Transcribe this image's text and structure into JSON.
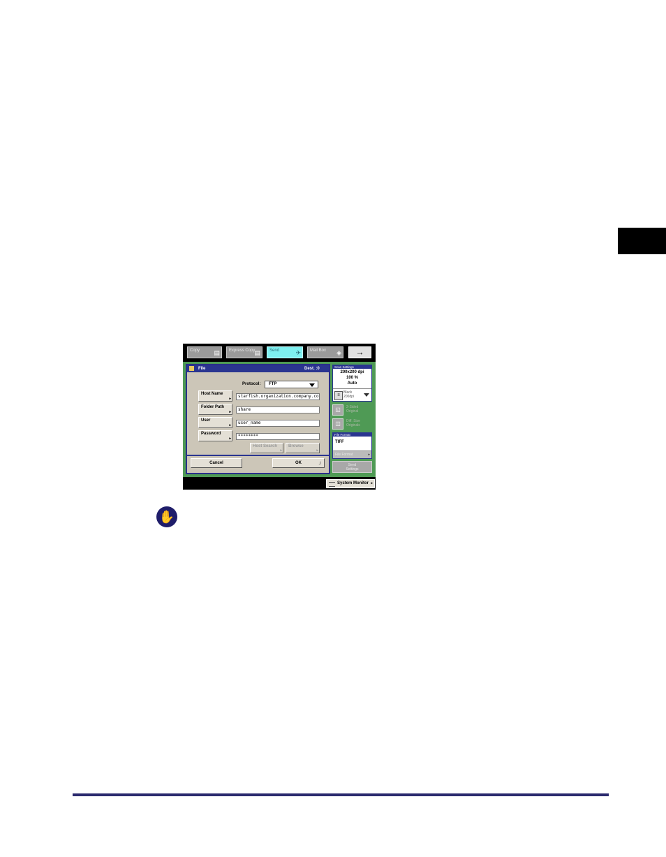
{
  "tabs": [
    {
      "label": "Copy",
      "icon": "copy-icon"
    },
    {
      "label": "Express Copy",
      "icon": "express-copy-icon"
    },
    {
      "label": "Send",
      "icon": "send-icon"
    },
    {
      "label": "Mail Box",
      "icon": "mailbox-icon"
    }
  ],
  "next_arrow": "→",
  "dialog": {
    "title": "File",
    "dest_label": "Dest. :0",
    "protocol_label": "Protocol:",
    "protocol_value": "FTP",
    "fields": [
      {
        "button": "Host Name",
        "value": "starfish.organization.company.co"
      },
      {
        "button": "Folder Path",
        "value": "share"
      },
      {
        "button": "User",
        "value": "user_name"
      },
      {
        "button": "Password",
        "value": "********"
      }
    ],
    "host_search_label": "Host Search",
    "browse_label": "Browse",
    "cancel_label": "Cancel",
    "ok_label": "OK"
  },
  "side": {
    "scan_header": "Scan Settings",
    "resolution": "200x200 dpi",
    "zoom": "100 %",
    "density": "Auto",
    "mode_line1": "Black",
    "mode_line2": "200dpi",
    "two_sided_line1": "2-Sided",
    "two_sided_line2": "Original",
    "book_line1": "Diff. Size",
    "book_line2": "Originals",
    "file_format_header": "File Format",
    "file_format_value": "TIFF",
    "file_format_button": "File Format",
    "send_settings_line1": "Send",
    "send_settings_line2": "Settings"
  },
  "system_monitor_label": "System Monitor",
  "colors": {
    "accent": "#2a3590",
    "panel_green": "#4f9a55",
    "active_tab": "#7ef0f0",
    "footer_rule": "#2b2a6e"
  }
}
